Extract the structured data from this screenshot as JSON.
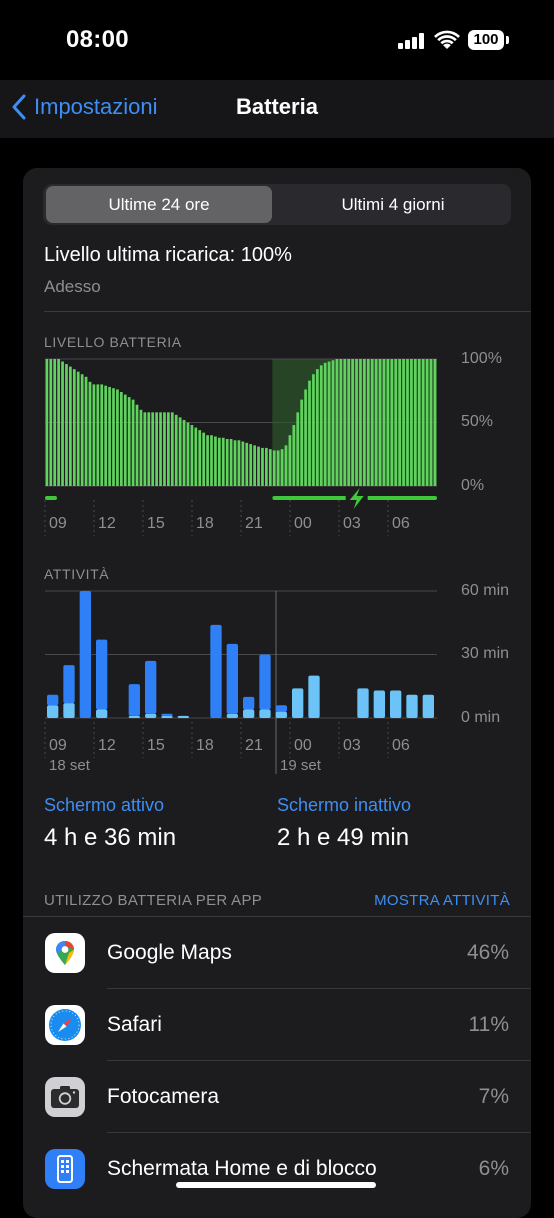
{
  "status_bar": {
    "time": "08:00",
    "battery": "100"
  },
  "nav": {
    "back_label": "Impostazioni",
    "title": "Batteria"
  },
  "segmented": {
    "left": "Ultime 24 ore",
    "right": "Ultimi 4 giorni",
    "selected": "left"
  },
  "last_charge": {
    "label": "Livello ultima ricarica: 100%",
    "time": "Adesso"
  },
  "battery_chart": {
    "section_label": "LIVELLO BATTERIA",
    "y_labels": [
      "100%",
      "50%",
      "0%"
    ],
    "x_labels": [
      "09",
      "12",
      "15",
      "18",
      "21",
      "00",
      "03",
      "06"
    ]
  },
  "activity_chart": {
    "section_label": "ATTIVITÀ",
    "y_labels": [
      "60 min",
      "30 min",
      "0 min"
    ],
    "x_labels": [
      "09",
      "12",
      "15",
      "18",
      "21",
      "00",
      "03",
      "06"
    ],
    "date_labels": [
      "18 set",
      "19 set"
    ]
  },
  "chart_data": [
    {
      "type": "bar",
      "title": "LIVELLO BATTERIA",
      "ylabel": "",
      "ylim": [
        0,
        100
      ],
      "y_ticks": [
        "0%",
        "50%",
        "100%"
      ],
      "x_ticks": [
        "09",
        "12",
        "15",
        "18",
        "21",
        "00",
        "03",
        "06"
      ],
      "colors": {
        "bar": "#5fd35d",
        "charging_band": "#2f5f2c",
        "charging_line": "#3ec83a"
      },
      "values": [
        100,
        100,
        100,
        100,
        98,
        96,
        94,
        92,
        90,
        88,
        86,
        82,
        80,
        80,
        80,
        79,
        78,
        77,
        76,
        74,
        72,
        70,
        68,
        64,
        60,
        58,
        58,
        58,
        58,
        58,
        58,
        58,
        58,
        56,
        54,
        52,
        50,
        48,
        46,
        44,
        42,
        40,
        40,
        39,
        38,
        38,
        37,
        37,
        36,
        36,
        35,
        34,
        33,
        32,
        31,
        30,
        30,
        29,
        28,
        28,
        29,
        32,
        40,
        48,
        58,
        68,
        76,
        83,
        88,
        92,
        95,
        97,
        98,
        99,
        100,
        100,
        100,
        100,
        100,
        100,
        100,
        100,
        100,
        100,
        100,
        100,
        100,
        100,
        100,
        100,
        100,
        100,
        100,
        100,
        100,
        100,
        100,
        100,
        100,
        100
      ],
      "charging_intervals": [
        [
          58,
          99
        ]
      ]
    },
    {
      "type": "bar",
      "title": "ATTIVITÀ",
      "ylim": [
        0,
        60
      ],
      "y_ticks": [
        "0 min",
        "30 min",
        "60 min"
      ],
      "x_ticks": [
        "09",
        "12",
        "15",
        "18",
        "21",
        "00",
        "03",
        "06"
      ],
      "series": [
        {
          "name": "Schermo attivo",
          "color": "#2f7ff6",
          "values": [
            5,
            18,
            60,
            33,
            0,
            15,
            25,
            1,
            0,
            0,
            44,
            33,
            6,
            26,
            3,
            0,
            0,
            0,
            0,
            0,
            0,
            0,
            0,
            0
          ]
        },
        {
          "name": "Schermo inattivo",
          "color": "#6bc3f7",
          "values": [
            6,
            7,
            0,
            4,
            0,
            1,
            2,
            1,
            1,
            0,
            0,
            2,
            4,
            4,
            3,
            14,
            20,
            0,
            0,
            14,
            13,
            13,
            11,
            11,
            13
          ]
        }
      ]
    }
  ],
  "screen": {
    "active_label": "Schermo attivo",
    "active_value": "4 h e 36 min",
    "inactive_label": "Schermo inattivo",
    "inactive_value": "2 h e 49 min"
  },
  "apps": {
    "header": "UTILIZZO BATTERIA PER APP",
    "link": "MOSTRA ATTIVITÀ",
    "items": [
      {
        "name": "Google Maps",
        "percent": "46%",
        "icon": "google-maps-icon"
      },
      {
        "name": "Safari",
        "percent": "11%",
        "icon": "safari-icon"
      },
      {
        "name": "Fotocamera",
        "percent": "7%",
        "icon": "camera-icon"
      },
      {
        "name": "Schermata Home e di blocco",
        "percent": "6%",
        "icon": "home-lock-screen-icon"
      }
    ]
  }
}
